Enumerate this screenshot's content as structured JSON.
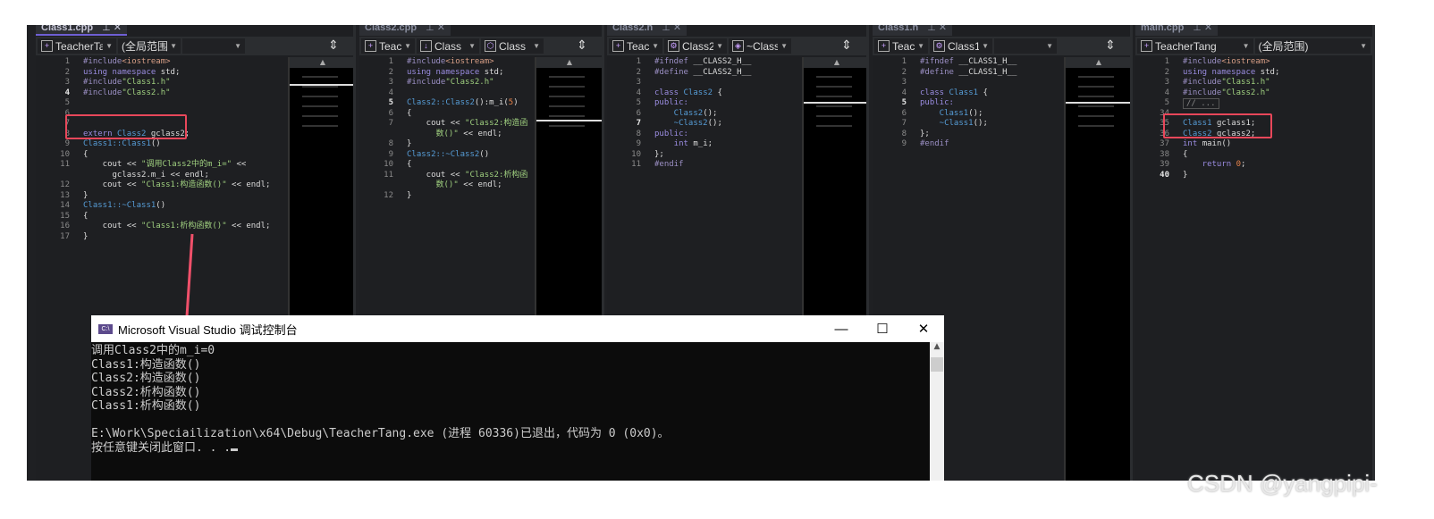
{
  "panes": [
    {
      "tab": "Class1.cpp",
      "active": true,
      "toolbar": [
        {
          "icon": "project-icon",
          "label": "TeacherTa"
        },
        {
          "label": "(全局范围)"
        },
        {
          "label": ""
        }
      ],
      "lines": [
        {
          "n": "1",
          "t": [
            [
              "pp",
              "#include"
            ],
            [
              "hdr",
              "<iostream>"
            ]
          ]
        },
        {
          "n": "2",
          "t": [
            [
              "kw",
              "using namespace "
            ],
            [
              "pl",
              "std;"
            ]
          ]
        },
        {
          "n": "3",
          "t": [
            [
              "pp",
              "#include"
            ],
            [
              "str",
              "\"Class1.h\""
            ]
          ]
        },
        {
          "n": "4",
          "cur": true,
          "t": [
            [
              "pp",
              "#include"
            ],
            [
              "str",
              "\"Class2.h\""
            ]
          ]
        },
        {
          "n": "5",
          "t": []
        },
        {
          "n": "6",
          "t": []
        },
        {
          "n": "7",
          "t": []
        },
        {
          "n": "8",
          "t": [
            [
              "kw",
              "extern "
            ],
            [
              "ty",
              "Class2 "
            ],
            [
              "pl",
              "gclass2;"
            ]
          ]
        },
        {
          "n": "9",
          "t": [
            [
              "ty",
              "Class1::Class1"
            ],
            [
              "pl",
              "()"
            ]
          ]
        },
        {
          "n": "10",
          "t": [
            [
              "pl",
              "{"
            ]
          ]
        },
        {
          "n": "11",
          "t": [
            [
              "pl",
              "    cout << "
            ],
            [
              "str",
              "\"调用Class2中的m_i=\""
            ],
            [
              "pl",
              " <<"
            ]
          ]
        },
        {
          "n": "",
          "t": [
            [
              "pl",
              "      gclass2.m_i << endl;"
            ]
          ]
        },
        {
          "n": "12",
          "t": [
            [
              "pl",
              "    cout << "
            ],
            [
              "str",
              "\"Class1:构造函数()\""
            ],
            [
              "pl",
              " << endl;"
            ]
          ]
        },
        {
          "n": "13",
          "t": [
            [
              "pl",
              "}"
            ]
          ]
        },
        {
          "n": "14",
          "t": [
            [
              "ty",
              "Class1::~Class1"
            ],
            [
              "pl",
              "()"
            ]
          ]
        },
        {
          "n": "15",
          "t": [
            [
              "pl",
              "{"
            ]
          ]
        },
        {
          "n": "16",
          "t": [
            [
              "pl",
              "    cout << "
            ],
            [
              "str",
              "\"Class1:析构函数()\""
            ],
            [
              "pl",
              " << endl;"
            ]
          ]
        },
        {
          "n": "17",
          "t": [
            [
              "pl",
              "}"
            ]
          ]
        }
      ]
    },
    {
      "tab": "Class2.cpp",
      "toolbar": [
        {
          "icon": "project-icon",
          "label": "Teacl"
        },
        {
          "icon": "arrow-down-icon",
          "label": "Class"
        },
        {
          "icon": "cube-icon",
          "label": "Class"
        }
      ],
      "lines": [
        {
          "n": "1",
          "t": [
            [
              "pp",
              "#include"
            ],
            [
              "hdr",
              "<iostream>"
            ]
          ]
        },
        {
          "n": "2",
          "t": [
            [
              "kw",
              "using namespace "
            ],
            [
              "pl",
              "std;"
            ]
          ]
        },
        {
          "n": "3",
          "t": [
            [
              "pp",
              "#include"
            ],
            [
              "str",
              "\"Class2.h\""
            ]
          ]
        },
        {
          "n": "4",
          "t": []
        },
        {
          "n": "5",
          "cur": true,
          "t": [
            [
              "ty",
              "Class2::Class2"
            ],
            [
              "pl",
              "():m_i("
            ],
            [
              "num",
              "5"
            ],
            [
              "pl",
              ")"
            ]
          ]
        },
        {
          "n": "6",
          "t": [
            [
              "pl",
              "{"
            ]
          ]
        },
        {
          "n": "7",
          "t": [
            [
              "pl",
              "    cout << "
            ],
            [
              "str",
              "\"Class2:构造函"
            ]
          ]
        },
        {
          "n": "",
          "t": [
            [
              "str",
              "      数()\""
            ],
            [
              "pl",
              " << endl;"
            ]
          ]
        },
        {
          "n": "8",
          "t": [
            [
              "pl",
              "}"
            ]
          ]
        },
        {
          "n": "9",
          "t": [
            [
              "ty",
              "Class2::~Class2"
            ],
            [
              "pl",
              "()"
            ]
          ]
        },
        {
          "n": "10",
          "t": [
            [
              "pl",
              "{"
            ]
          ]
        },
        {
          "n": "11",
          "t": [
            [
              "pl",
              "    cout << "
            ],
            [
              "str",
              "\"Class2:析构函"
            ]
          ]
        },
        {
          "n": "",
          "t": [
            [
              "str",
              "      数()\""
            ],
            [
              "pl",
              " << endl;"
            ]
          ]
        },
        {
          "n": "12",
          "t": [
            [
              "pl",
              "}"
            ]
          ]
        }
      ]
    },
    {
      "tab": "Class2.h",
      "toolbar": [
        {
          "icon": "project-icon",
          "label": "Teach"
        },
        {
          "icon": "class-icon",
          "label": "Class2"
        },
        {
          "icon": "method-icon",
          "label": "~Class"
        }
      ],
      "lines": [
        {
          "n": "1",
          "t": [
            [
              "pp",
              "#ifndef "
            ],
            [
              "pl",
              "__CLASS2_H__"
            ]
          ]
        },
        {
          "n": "2",
          "t": [
            [
              "pp",
              "#define "
            ],
            [
              "pl",
              "__CLASS2_H__"
            ]
          ]
        },
        {
          "n": "3",
          "t": []
        },
        {
          "n": "4",
          "t": [
            [
              "kw",
              "class "
            ],
            [
              "ty",
              "Class2 "
            ],
            [
              "pl",
              "{"
            ]
          ]
        },
        {
          "n": "5",
          "t": [
            [
              "kw",
              "public:"
            ]
          ]
        },
        {
          "n": "6",
          "t": [
            [
              "ty",
              "    Class2"
            ],
            [
              "pl",
              "();"
            ]
          ]
        },
        {
          "n": "7",
          "cur": true,
          "t": [
            [
              "ty",
              "    ~Class2"
            ],
            [
              "pl",
              "();"
            ]
          ]
        },
        {
          "n": "8",
          "t": [
            [
              "kw",
              "public:"
            ]
          ]
        },
        {
          "n": "9",
          "t": [
            [
              "kw",
              "    int "
            ],
            [
              "pl",
              "m_i;"
            ]
          ]
        },
        {
          "n": "10",
          "t": [
            [
              "pl",
              "};"
            ]
          ]
        },
        {
          "n": "11",
          "t": [
            [
              "pp",
              "#endif"
            ]
          ]
        }
      ]
    },
    {
      "tab": "Class1.h",
      "toolbar": [
        {
          "icon": "project-icon",
          "label": "Teach"
        },
        {
          "icon": "class-icon",
          "label": "Class1"
        },
        {
          "label": ""
        }
      ],
      "lines": [
        {
          "n": "1",
          "t": [
            [
              "pp",
              "#ifndef "
            ],
            [
              "pl",
              "__CLASS1_H__"
            ]
          ]
        },
        {
          "n": "2",
          "t": [
            [
              "pp",
              "#define "
            ],
            [
              "pl",
              "__CLASS1_H__"
            ]
          ]
        },
        {
          "n": "3",
          "t": []
        },
        {
          "n": "4",
          "t": [
            [
              "kw",
              "class "
            ],
            [
              "ty",
              "Class1 "
            ],
            [
              "pl",
              "{"
            ]
          ]
        },
        {
          "n": "5",
          "cur": true,
          "t": [
            [
              "kw",
              "public:"
            ]
          ]
        },
        {
          "n": "6",
          "t": [
            [
              "ty",
              "    Class1"
            ],
            [
              "pl",
              "();"
            ]
          ]
        },
        {
          "n": "7",
          "t": [
            [
              "ty",
              "    ~Class1"
            ],
            [
              "pl",
              "();"
            ]
          ]
        },
        {
          "n": "8",
          "t": [
            [
              "pl",
              "};"
            ]
          ]
        },
        {
          "n": "9",
          "t": [
            [
              "pp",
              "#endif"
            ]
          ]
        }
      ]
    },
    {
      "tab": "main.cpp",
      "toolbar": [
        {
          "icon": "project-icon",
          "label": "TeacherTang"
        },
        {
          "label": "(全局范围)"
        }
      ],
      "lines": [
        {
          "n": "1",
          "t": [
            [
              "pp",
              "#include"
            ],
            [
              "hdr",
              "<iostream>"
            ]
          ]
        },
        {
          "n": "2",
          "t": [
            [
              "kw",
              "using namespace "
            ],
            [
              "pl",
              "std;"
            ]
          ]
        },
        {
          "n": "3",
          "t": [
            [
              "pp",
              "#include"
            ],
            [
              "str",
              "\"Class1.h\""
            ]
          ]
        },
        {
          "n": "4",
          "t": [
            [
              "pp",
              "#include"
            ],
            [
              "str",
              "\"Class2.h\""
            ]
          ]
        },
        {
          "n": "5",
          "t": [
            [
              "fold",
              "// ..."
            ]
          ]
        },
        {
          "n": "34",
          "t": []
        },
        {
          "n": "35",
          "t": [
            [
              "ty",
              "Class1 "
            ],
            [
              "pl",
              "gclass1;"
            ]
          ]
        },
        {
          "n": "36",
          "t": [
            [
              "ty",
              "Class2 "
            ],
            [
              "pl",
              "gclass2;"
            ]
          ]
        },
        {
          "n": "37",
          "t": [
            [
              "kw",
              "int "
            ],
            [
              "pl",
              "main()"
            ]
          ]
        },
        {
          "n": "38",
          "t": [
            [
              "pl",
              "{"
            ]
          ]
        },
        {
          "n": "39",
          "t": [
            [
              "kw",
              "    return "
            ],
            [
              "num",
              "0"
            ],
            [
              "pl",
              ";"
            ]
          ]
        },
        {
          "n": "40",
          "cur": true,
          "t": [
            [
              "pl",
              "}"
            ]
          ]
        }
      ]
    }
  ],
  "console": {
    "title": "Microsoft Visual Studio 调试控制台",
    "icon_text": "C:\\",
    "minimize": "—",
    "maximize": "☐",
    "close": "✕",
    "lines": [
      "调用Class2中的m_i=0",
      "Class1:构造函数()",
      "Class2:构造函数()",
      "Class2:析构函数()",
      "Class1:析构函数()",
      "",
      "E:\\Work\\Speciailization\\x64\\Debug\\TeacherTang.exe (进程 60336)已退出，代码为 0 (0x0)。",
      "按任意键关闭此窗口. . ."
    ]
  },
  "annotation_color": "#e8475a",
  "watermark": "CSDN @yangpipi-"
}
